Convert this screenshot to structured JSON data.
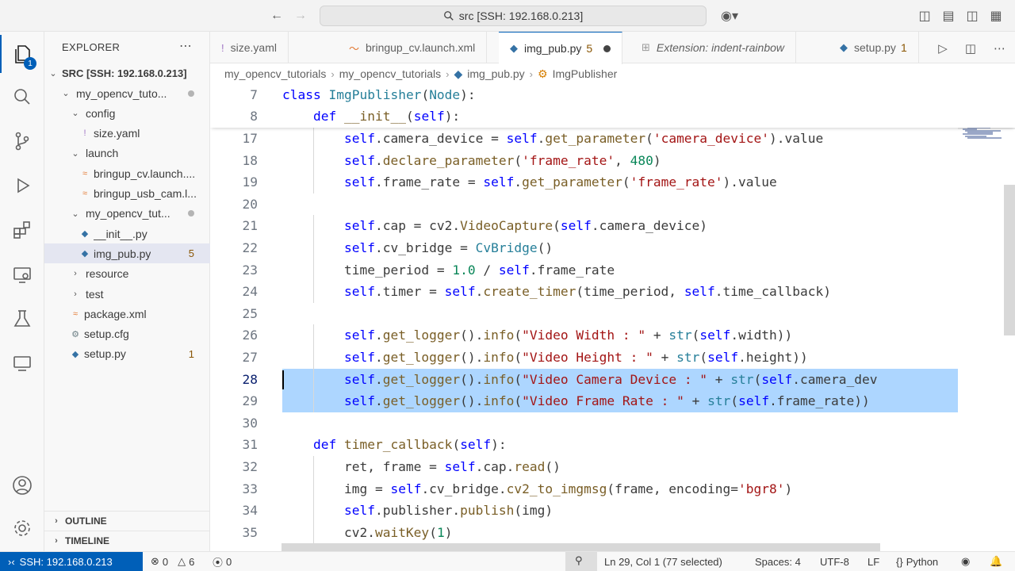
{
  "titlebar": {
    "search_text": "src [SSH: 192.168.0.213]"
  },
  "activity": {
    "explorer_badge": "1"
  },
  "sidebar": {
    "header": "EXPLORER",
    "root": "SRC [SSH: 192.168.0.213]",
    "tree": [
      {
        "label": "my_opencv_tuto...",
        "indent": 1,
        "type": "folder-open",
        "dot": true
      },
      {
        "label": "config",
        "indent": 2,
        "type": "folder-open"
      },
      {
        "label": "size.yaml",
        "indent": 3,
        "type": "yaml"
      },
      {
        "label": "launch",
        "indent": 2,
        "type": "folder-open"
      },
      {
        "label": "bringup_cv.launch....",
        "indent": 3,
        "type": "xml"
      },
      {
        "label": "bringup_usb_cam.l...",
        "indent": 3,
        "type": "xml"
      },
      {
        "label": "my_opencv_tut...",
        "indent": 2,
        "type": "folder-open",
        "dot": true
      },
      {
        "label": "__init__.py",
        "indent": 3,
        "type": "py"
      },
      {
        "label": "img_pub.py",
        "indent": 3,
        "type": "py",
        "count": "5",
        "selected": true
      },
      {
        "label": "resource",
        "indent": 2,
        "type": "folder-closed"
      },
      {
        "label": "test",
        "indent": 2,
        "type": "folder-closed"
      },
      {
        "label": "package.xml",
        "indent": 2,
        "type": "xml"
      },
      {
        "label": "setup.cfg",
        "indent": 2,
        "type": "gear"
      },
      {
        "label": "setup.py",
        "indent": 2,
        "type": "py",
        "count": "1"
      }
    ],
    "outline": "OUTLINE",
    "timeline": "TIMELINE"
  },
  "tabs": [
    {
      "label": "size.yaml",
      "icon": "!",
      "icon_color": "#a074c4"
    },
    {
      "label": "bringup_cv.launch.xml",
      "icon": "〜",
      "icon_color": "#e37933"
    },
    {
      "label": "img_pub.py",
      "icon": "◆",
      "icon_color": "#3572a5",
      "count": "5",
      "active": true,
      "modified": true
    },
    {
      "label": "Extension: indent-rainbow",
      "icon": "⊞",
      "icon_color": "#999999",
      "italic": true
    },
    {
      "label": "setup.py",
      "icon": "◆",
      "icon_color": "#3572a5",
      "count": "1"
    }
  ],
  "breadcrumb": [
    "my_opencv_tutorials",
    "my_opencv_tutorials",
    "img_pub.py",
    "ImgPublisher"
  ],
  "editor": {
    "sticky": [
      {
        "ln": "7",
        "text": "class ImgPublisher(Node):"
      },
      {
        "ln": "8",
        "text": "    def __init__(self):"
      }
    ],
    "lines": [
      {
        "ln": "17",
        "text": "        self.camera_device = self.get_parameter('camera_device').value"
      },
      {
        "ln": "18",
        "text": "        self.declare_parameter('frame_rate', 480)"
      },
      {
        "ln": "19",
        "text": "        self.frame_rate = self.get_parameter('frame_rate').value"
      },
      {
        "ln": "20",
        "text": ""
      },
      {
        "ln": "21",
        "text": "        self.cap = cv2.VideoCapture(self.camera_device)"
      },
      {
        "ln": "22",
        "text": "        self.cv_bridge = CvBridge()"
      },
      {
        "ln": "23",
        "text": "        time_period = 1.0 / self.frame_rate"
      },
      {
        "ln": "24",
        "text": "        self.timer = self.create_timer(time_period, self.time_callback)"
      },
      {
        "ln": "25",
        "text": ""
      },
      {
        "ln": "26",
        "text": "        self.get_logger().info(\"Video Width : \" + str(self.width))"
      },
      {
        "ln": "27",
        "text": "        self.get_logger().info(\"Video Height : \" + str(self.height))"
      },
      {
        "ln": "28",
        "text": "        self.get_logger().info(\"Video Camera Device : \" + str(self.camera_dev",
        "selected": true,
        "cursor": true
      },
      {
        "ln": "29",
        "text": "        self.get_logger().info(\"Video Frame Rate : \" + str(self.frame_rate))",
        "selected": true
      },
      {
        "ln": "30",
        "text": ""
      },
      {
        "ln": "31",
        "text": "    def timer_callback(self):"
      },
      {
        "ln": "32",
        "text": "        ret, frame = self.cap.read()"
      },
      {
        "ln": "33",
        "text": "        img = self.cv_bridge.cv2_to_imgmsg(frame, encoding='bgr8')"
      },
      {
        "ln": "34",
        "text": "        self.publisher.publish(img)"
      },
      {
        "ln": "35",
        "text": "        cv2.waitKey(1)"
      }
    ]
  },
  "status": {
    "remote": "SSH: 192.168.0.213",
    "errors": "0",
    "warnings": "6",
    "ports": "0",
    "position": "Ln 29, Col 1 (77 selected)",
    "spaces": "Spaces: 4",
    "encoding": "UTF-8",
    "eol": "LF",
    "language": "Python"
  }
}
